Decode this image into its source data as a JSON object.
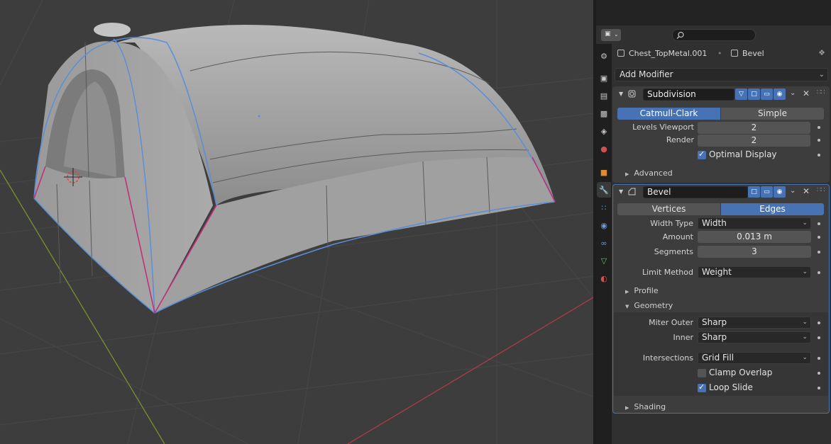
{
  "properties": {
    "object_name": "Chest_TopMetal.001",
    "modifier_context": "Bevel",
    "add_modifier_label": "Add Modifier",
    "tab_icons": [
      "tool-icon",
      "render-icon",
      "output-icon",
      "view-layer-icon",
      "scene-icon",
      "world-icon",
      "object-icon",
      "modifier-icon",
      "particles-icon",
      "physics-icon",
      "constraints-icon",
      "object-data-icon",
      "material-icon"
    ]
  },
  "subdivision": {
    "name": "Subdivision",
    "mode_options": [
      "Catmull-Clark",
      "Simple"
    ],
    "mode_selected": "Catmull-Clark",
    "levels_viewport_label": "Levels Viewport",
    "levels_viewport_value": "2",
    "render_label": "Render",
    "render_value": "2",
    "optimal_display_label": "Optimal Display",
    "optimal_display_checked": true,
    "advanced_label": "Advanced"
  },
  "bevel": {
    "name": "Bevel",
    "affect_options": [
      "Vertices",
      "Edges"
    ],
    "affect_selected": "Edges",
    "width_type_label": "Width Type",
    "width_type_value": "Width",
    "amount_label": "Amount",
    "amount_value": "0.013 m",
    "segments_label": "Segments",
    "segments_value": "3",
    "limit_method_label": "Limit Method",
    "limit_method_value": "Weight",
    "profile_label": "Profile",
    "geometry_label": "Geometry",
    "miter_outer_label": "Miter Outer",
    "miter_outer_value": "Sharp",
    "inner_label": "Inner",
    "inner_value": "Sharp",
    "intersections_label": "Intersections",
    "intersections_value": "Grid Fill",
    "clamp_overlap_label": "Clamp Overlap",
    "clamp_overlap_checked": false,
    "loop_slide_label": "Loop Slide",
    "loop_slide_checked": true,
    "shading_label": "Shading"
  },
  "colors": {
    "accent": "#4772b3",
    "edge_crease": "#c2307a",
    "edge_select": "#5b8ed8",
    "axis_x": "#b63a4a",
    "axis_y": "#7a9a2a"
  }
}
